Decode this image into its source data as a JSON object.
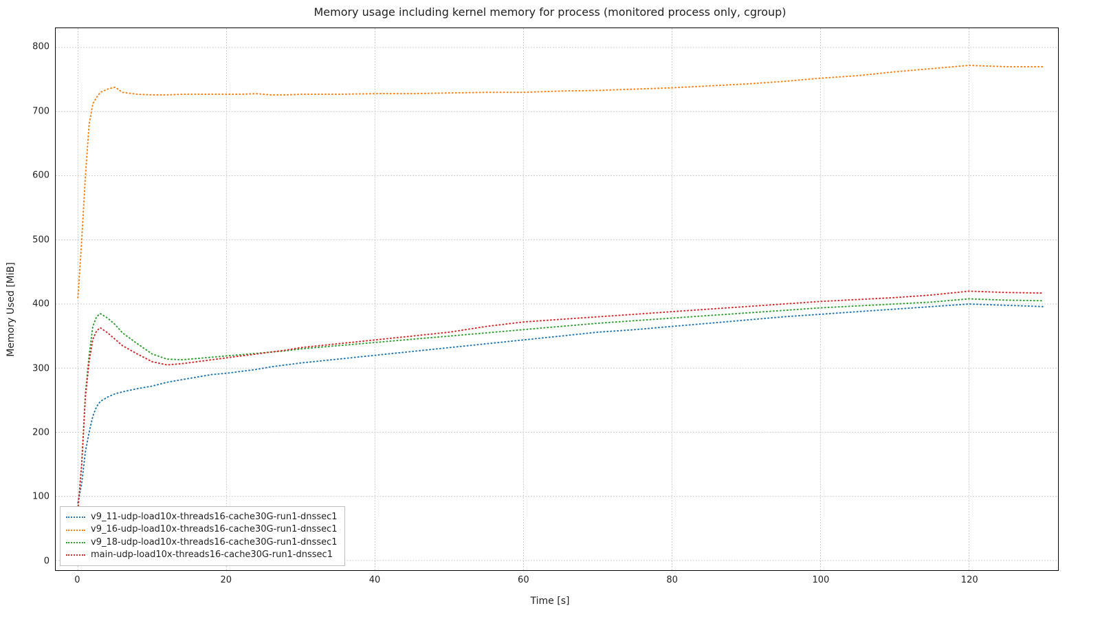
{
  "chart_data": {
    "type": "line",
    "title": "Memory usage including kernel memory for process (monitored process only, cgroup)",
    "xlabel": "Time [s]",
    "ylabel": "Memory Used [MiB]",
    "xlim": [
      -3,
      132
    ],
    "ylim": [
      -15,
      830
    ],
    "xticks": [
      0,
      20,
      40,
      60,
      80,
      100,
      120
    ],
    "yticks": [
      0,
      100,
      200,
      300,
      400,
      500,
      600,
      700,
      800
    ],
    "legend_position": "lower left",
    "x": [
      0,
      0.5,
      1,
      1.5,
      2,
      2.5,
      3,
      4,
      5,
      6,
      8,
      10,
      12,
      14,
      16,
      18,
      20,
      22,
      24,
      26,
      28,
      30,
      35,
      40,
      45,
      50,
      55,
      60,
      65,
      70,
      75,
      80,
      85,
      90,
      95,
      100,
      105,
      110,
      115,
      120,
      125,
      130
    ],
    "series": [
      {
        "name": "v9_11-udp-load10x-threads16-cache30G-run1-dnssec1",
        "color": "#1f77b4",
        "values": [
          90,
          120,
          170,
          200,
          225,
          240,
          248,
          255,
          260,
          263,
          268,
          272,
          278,
          282,
          286,
          290,
          292,
          295,
          298,
          302,
          305,
          308,
          314,
          320,
          326,
          332,
          338,
          344,
          350,
          356,
          360,
          365,
          370,
          375,
          380,
          384,
          388,
          392,
          396,
          400,
          398,
          396
        ]
      },
      {
        "name": "v9_16-udp-load10x-threads16-cache30G-run1-dnssec1",
        "color": "#ff7f0e",
        "values": [
          410,
          500,
          600,
          680,
          712,
          722,
          730,
          735,
          738,
          730,
          727,
          726,
          726,
          727,
          727,
          727,
          727,
          727,
          728,
          726,
          726,
          727,
          727,
          728,
          728,
          729,
          730,
          730,
          732,
          733,
          735,
          737,
          740,
          743,
          747,
          752,
          756,
          762,
          767,
          772,
          770,
          770
        ]
      },
      {
        "name": "v9_18-udp-load10x-threads16-cache30G-run1-dnssec1",
        "color": "#2ca02c",
        "values": [
          80,
          150,
          260,
          320,
          365,
          380,
          385,
          378,
          368,
          355,
          338,
          322,
          314,
          313,
          315,
          317,
          319,
          321,
          323,
          325,
          327,
          330,
          335,
          340,
          345,
          350,
          355,
          360,
          365,
          370,
          374,
          378,
          382,
          386,
          390,
          394,
          397,
          400,
          403,
          408,
          406,
          405
        ]
      },
      {
        "name": "main-udp-load10x-threads16-cache30G-run1-dnssec1",
        "color": "#d62728",
        "values": [
          80,
          150,
          255,
          310,
          345,
          358,
          363,
          355,
          345,
          335,
          322,
          310,
          305,
          307,
          310,
          313,
          316,
          319,
          322,
          325,
          328,
          332,
          338,
          344,
          350,
          356,
          365,
          372,
          376,
          380,
          384,
          388,
          392,
          396,
          400,
          404,
          407,
          410,
          414,
          420,
          418,
          417
        ]
      }
    ]
  }
}
